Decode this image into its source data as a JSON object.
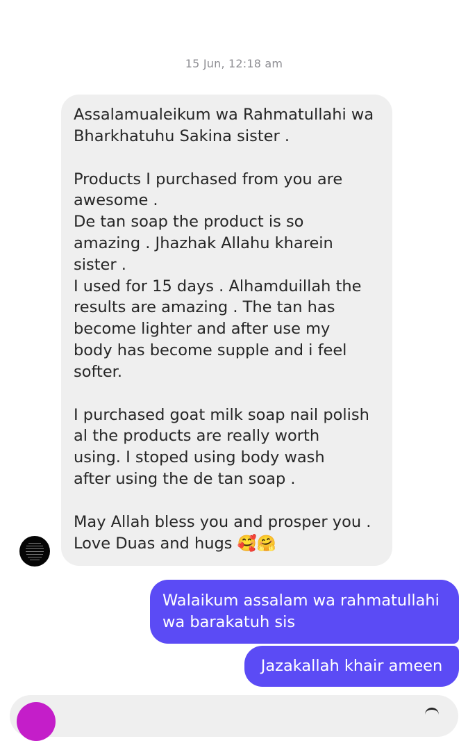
{
  "conversation": {
    "timestamp": "15 Jun, 12:18 am",
    "incoming": {
      "paragraphs": [
        "Assalamualeikum wa Rahmatullahi wa\nBharkhatuhu Sakina sister .",
        "",
        "Products I purchased from you are\nawesome .\nDe tan soap the product is so\namazing . Jhazhak Allahu kharein\nsister .\nI used for 15 days . Alhamduillah the\nresults are amazing . The tan has\nbecome lighter and after use my\nbody has become supple and i feel\nsofter.",
        "",
        "I purchased goat milk soap nail polish\nal the products are really worth\nusing.   I stoped using body wash\nafter using the de tan soap .",
        "",
        "May Allah bless you and prosper you .\nLove Duas and hugs 🥰🤗"
      ]
    },
    "outgoing": [
      "Walaikum assalam wa rahmatullahi\nwa barakatuh sis",
      "Jazakallah khair ameen"
    ]
  },
  "colors": {
    "incoming_bubble": "#efefef",
    "outgoing_bubble": "#5b4bf5",
    "timestamp_text": "#8e8e93",
    "composer_avatar": "#c41ec9"
  },
  "icons": {
    "sender_avatar": "avatar-image",
    "composer_avatar": "avatar-icon",
    "composer_action": "camera-icon"
  }
}
